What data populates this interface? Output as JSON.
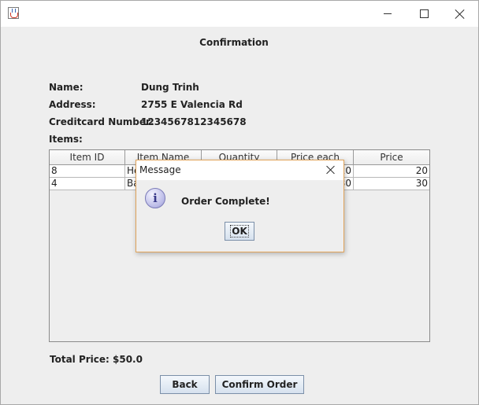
{
  "window": {
    "title": "",
    "controls": {
      "minimize_icon": "minimize-icon",
      "maximize_icon": "maximize-icon",
      "close_icon": "close-icon"
    }
  },
  "form": {
    "heading": "Confirmation",
    "name_label": "Name:",
    "name_value": "Dung Trinh",
    "address_label": "Address:",
    "address_value": "2755 E Valencia Rd",
    "card_label": "Creditcard Number:",
    "card_value": "1234567812345678",
    "items_label": "Items:"
  },
  "table": {
    "columns": [
      "Item ID",
      "Item Name",
      "Quantity",
      "Price each",
      "Price"
    ],
    "rows": [
      [
        "8",
        "He",
        "",
        "20",
        "20"
      ],
      [
        "4",
        "Ba",
        "",
        "30",
        "30"
      ]
    ]
  },
  "total": {
    "label": "Total Price:",
    "value": "$50.0"
  },
  "buttons": {
    "back": "Back",
    "confirm": "Confirm Order"
  },
  "dialog": {
    "title": "Message",
    "message": "Order Complete!",
    "ok": "OK",
    "icon": "information-icon",
    "border_color": "#e0a35a"
  }
}
